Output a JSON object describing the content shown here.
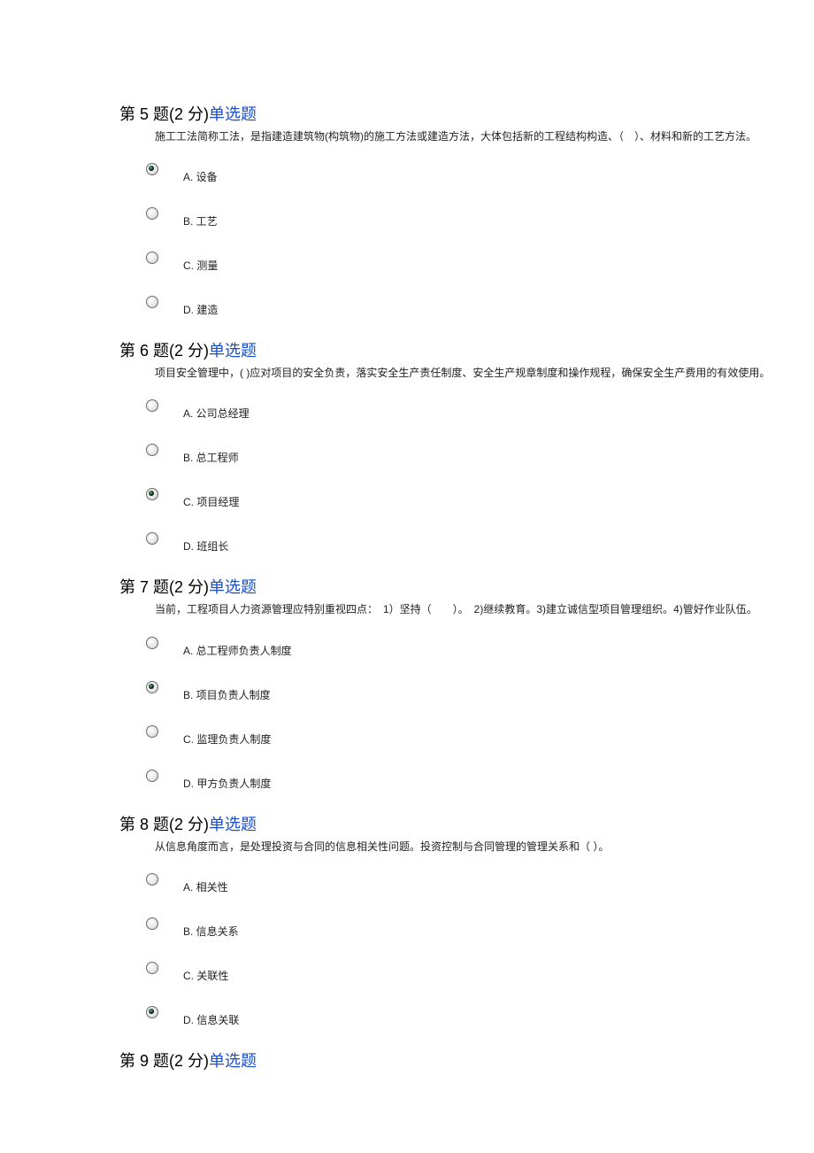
{
  "questions": [
    {
      "header_prefix": "第 5 题(2 分)",
      "header_type": "单选题",
      "prompt": "施工工法简称工法，是指建造建筑物(构筑物)的施工方法或建造方法，大体包括新的工程结构构造、（　）、材料和新的工艺方法。",
      "options": [
        {
          "label": "A. 设备",
          "selected": true
        },
        {
          "label": "B. 工艺",
          "selected": false
        },
        {
          "label": "C. 测量",
          "selected": false
        },
        {
          "label": "D. 建造",
          "selected": false
        }
      ]
    },
    {
      "header_prefix": "第 6 题(2 分)",
      "header_type": "单选题",
      "prompt": "项目安全管理中，( )应对项目的安全负责，落实安全生产责任制度、安全生产规章制度和操作规程，确保安全生产费用的有效使用。",
      "options": [
        {
          "label": "A. 公司总经理",
          "selected": false
        },
        {
          "label": "B. 总工程师",
          "selected": false
        },
        {
          "label": "C. 项目经理",
          "selected": true
        },
        {
          "label": "D. 班组长",
          "selected": false
        }
      ]
    },
    {
      "header_prefix": "第 7 题(2 分)",
      "header_type": "单选题",
      "prompt": "当前，工程项目人力资源管理应特别重视四点：　1）坚持（　　）。　2)继续教育。3)建立诚信型项目管理组织。4)管好作业队伍。",
      "options": [
        {
          "label": "A. 总工程师负责人制度",
          "selected": false
        },
        {
          "label": "B. 项目负责人制度",
          "selected": true
        },
        {
          "label": "C. 监理负责人制度",
          "selected": false
        },
        {
          "label": "D. 甲方负责人制度",
          "selected": false
        }
      ]
    },
    {
      "header_prefix": "第 8 题(2 分)",
      "header_type": "单选题",
      "prompt": "从信息角度而言，是处理投资与合同的信息相关性问题。投资控制与合同管理的管理关系和（ ）。",
      "options": [
        {
          "label": "A. 相关性",
          "selected": false
        },
        {
          "label": "B. 信息关系",
          "selected": false
        },
        {
          "label": "C. 关联性",
          "selected": false
        },
        {
          "label": "D. 信息关联",
          "selected": true
        }
      ]
    },
    {
      "header_prefix": "第 9 题(2 分)",
      "header_type": "单选题",
      "prompt": "",
      "options": []
    }
  ]
}
